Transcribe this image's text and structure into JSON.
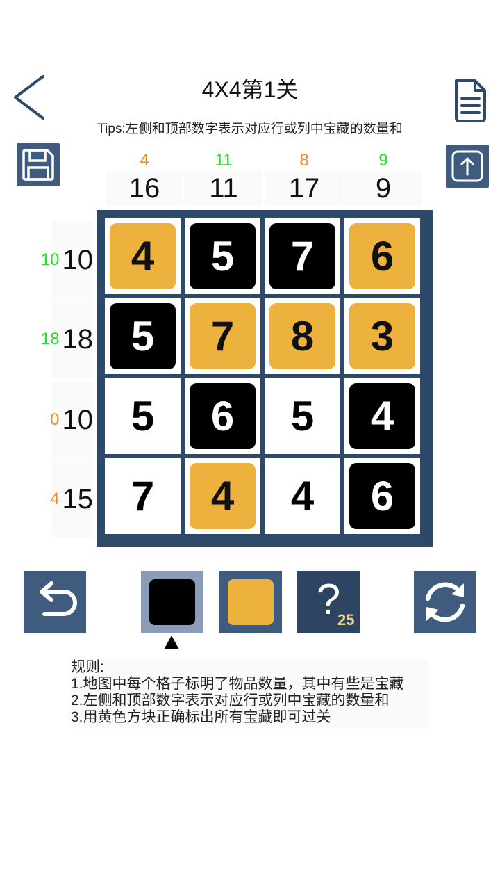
{
  "header": {
    "title": "4X4第1关",
    "tips": "Tips:左侧和顶部数字表示对应行或列中宝藏的数量和"
  },
  "icons": {
    "back": "chevron-left-icon",
    "document": "document-icon",
    "save": "save-icon",
    "share": "upload-icon",
    "undo": "undo-icon",
    "refresh": "refresh-icon"
  },
  "colors": {
    "accent": "#3f5c7e",
    "board_border": "#2e4a6b",
    "treasure_gold": "#edb13e",
    "clue_green": "#22dd22",
    "clue_orange": "#ee8a1a"
  },
  "column_clues": [
    {
      "current": "4",
      "target": "16",
      "status": "orange"
    },
    {
      "current": "11",
      "target": "11",
      "status": "green"
    },
    {
      "current": "8",
      "target": "17",
      "status": "orange"
    },
    {
      "current": "9",
      "target": "9",
      "status": "green"
    }
  ],
  "row_clues": [
    {
      "current": "10",
      "target": "10",
      "status": "green"
    },
    {
      "current": "18",
      "target": "18",
      "status": "green"
    },
    {
      "current": "0",
      "target": "10",
      "status": "orange"
    },
    {
      "current": "4",
      "target": "15",
      "status": "orange"
    }
  ],
  "grid": [
    [
      {
        "value": "4",
        "state": "gold"
      },
      {
        "value": "5",
        "state": "black"
      },
      {
        "value": "7",
        "state": "black"
      },
      {
        "value": "6",
        "state": "gold"
      }
    ],
    [
      {
        "value": "5",
        "state": "black"
      },
      {
        "value": "7",
        "state": "gold"
      },
      {
        "value": "8",
        "state": "gold"
      },
      {
        "value": "3",
        "state": "gold"
      }
    ],
    [
      {
        "value": "5",
        "state": "white"
      },
      {
        "value": "6",
        "state": "black"
      },
      {
        "value": "5",
        "state": "white"
      },
      {
        "value": "4",
        "state": "black"
      }
    ],
    [
      {
        "value": "7",
        "state": "white"
      },
      {
        "value": "4",
        "state": "gold"
      },
      {
        "value": "4",
        "state": "white"
      },
      {
        "value": "6",
        "state": "black"
      }
    ]
  ],
  "toolbar": {
    "selected_tool": "black",
    "hint_symbol": "?",
    "hint_count": "25"
  },
  "rules": {
    "heading": "规则:",
    "lines": [
      "1.地图中每个格子标明了物品数量，其中有些是宝藏",
      "2.左侧和顶部数字表示对应行或列中宝藏的数量和",
      "3.用黄色方块正确标出所有宝藏即可过关"
    ]
  }
}
